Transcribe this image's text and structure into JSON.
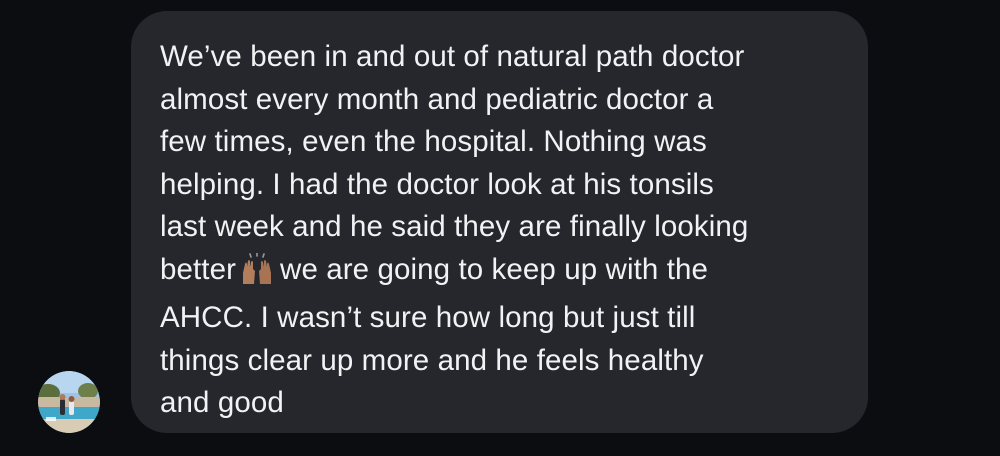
{
  "conversation": {
    "message": {
      "text_before_emoji": "We’ve been in and out of natural path doctor\nalmost every month and pediatric doctor a\nfew times, even the hospital. Nothing was\nhelping. I had the doctor look at his tonsils\nlast week and he said they are finally looking\nbetter",
      "emoji": "raising-hands",
      "text_after_emoji": "we are going to keep up with the\nAHCC. I wasn’t sure how long but just till\nthings clear up more and he feels healthy\nand good"
    },
    "sender_avatar": "profile-photo"
  },
  "colors": {
    "background": "#0b0d10",
    "bubble": "#25272c",
    "text": "#f2f2f4"
  }
}
